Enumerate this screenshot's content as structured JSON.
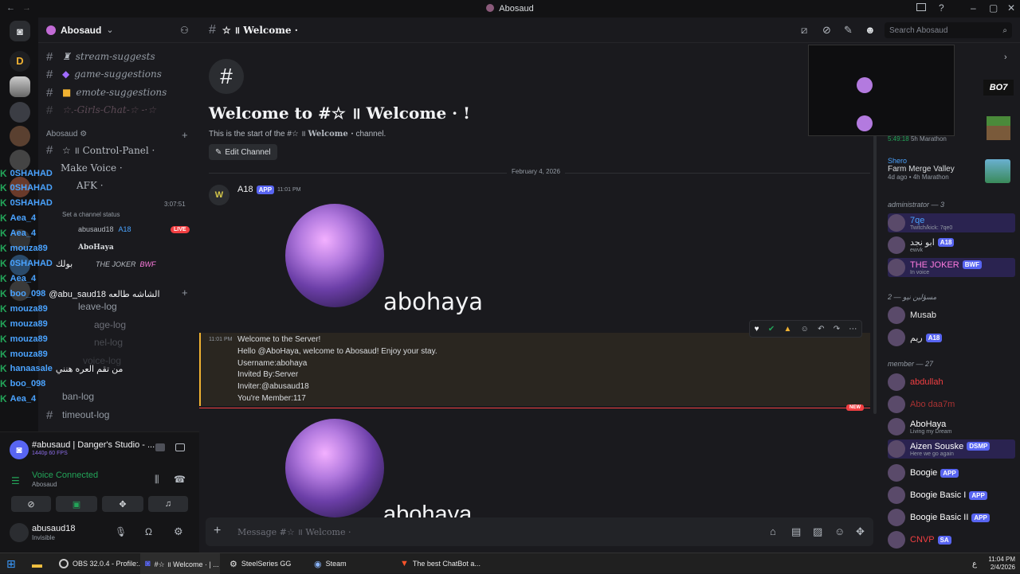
{
  "window": {
    "title": "Abosaud"
  },
  "server": {
    "name": "Abosaud",
    "dropdown": "⌄"
  },
  "channels": {
    "top": [
      {
        "label": "stream-suggests"
      },
      {
        "label": "game-suggestions"
      },
      {
        "label": "emote-suggestions"
      },
      {
        "label": "☆.-Girls-Chat-☆ -·☆"
      }
    ],
    "category": "Abosaud",
    "control_panel": "☆ ॥ Control-Panel ·",
    "make_voice": "Make Voice ·",
    "afk": "AFK ·",
    "voice_time": "3:07:51",
    "voice_status": "Set a channel status",
    "voice_user": "abusaud18",
    "voice_user_tag": "A18",
    "live": "LIVE",
    "voice_user2": "AboHaya",
    "voice_user3": "THE JOKER",
    "voice_user3_tag": "BWF",
    "logs": [
      "leave-log",
      "age-log",
      "nel-log",
      "voice-log",
      "ban-log",
      "timeout-log"
    ]
  },
  "overlay": {
    "rows": [
      {
        "name": "0SHAHAD",
        "text": ""
      },
      {
        "name": "0SHAHAD",
        "text": ""
      },
      {
        "name": "0SHAHAD",
        "text": ""
      },
      {
        "name": "Aea_4",
        "text": ""
      },
      {
        "name": "Aea_4",
        "text": ""
      },
      {
        "name": "mouza89",
        "text": ""
      },
      {
        "name": "0SHAHAD",
        "text": "بولك"
      },
      {
        "name": "Aea_4",
        "text": ""
      },
      {
        "name": "boo_098",
        "text": "@abu_saud18 الشاشه طالعه"
      },
      {
        "name": "mouza89",
        "text": ""
      },
      {
        "name": "mouza89",
        "text": ""
      },
      {
        "name": "mouza89",
        "text": ""
      },
      {
        "name": "mouza89",
        "text": ""
      },
      {
        "name": "hanaasale",
        "text": "من تقم العره هنني"
      },
      {
        "name": "boo_098",
        "text": ""
      },
      {
        "name": "Aea_4",
        "text": ""
      }
    ]
  },
  "user_panel": {
    "activity_title": "#abusaud | Danger's Studio - ...",
    "activity_sub": "1440p 60 FPS",
    "voice_connected": "Voice Connected",
    "voice_channel": "Abosaud",
    "username": "abusaud18",
    "status": "Invisible"
  },
  "header": {
    "channel": "☆ ॥ Welcome ·",
    "search_placeholder": "Search Abosaud"
  },
  "welcome": {
    "title": "Welcome to #☆ ॥ Welcome · !",
    "subtitle_pre": "This is the start of the #☆ ॥",
    "subtitle_channel": "Welcome ·",
    "subtitle_post": "channel.",
    "edit_button": "Edit Channel"
  },
  "divider_date": "February 4, 2026",
  "messages": [
    {
      "author": "A18",
      "tag": "APP",
      "time": "11:01 PM",
      "image_caption": "abohaya"
    },
    {
      "time": "11:01 PM",
      "lines": [
        "Welcome to the Server!",
        "Hello @AboHaya, welcome to Abosaud! Enjoy your stay.",
        "Username:abohaya",
        "Invited By:Server",
        "Inviter:@abusaud18",
        "You're Member:117"
      ],
      "new_badge": "NEW"
    },
    {
      "image_caption": "abohaya"
    }
  ],
  "composer": {
    "placeholder": "Message #☆ ॥ Welcome ·"
  },
  "members": {
    "activity1": {
      "time": "5:49:18",
      "extra": "5h Marathon"
    },
    "activity2": {
      "name": "Shero",
      "game": "Farm Merge Valley",
      "time": "4d ago",
      "extra": "4h Marathon"
    },
    "admin_header": "administrator — 3",
    "admins": [
      {
        "name": "7qe",
        "sub": "Twitch/kick: 7qe0",
        "color": "#4aa3ff"
      },
      {
        "name": "ابو نجد",
        "sub": "ewvk",
        "tag": "A18",
        "color": "#dbdee1"
      },
      {
        "name": "THE JOKER",
        "sub": "In voice",
        "tag": "BWF",
        "color": "#ff7be0"
      }
    ],
    "mod_header": "مسؤلين نيو — 2",
    "mods": [
      {
        "name": "Musab",
        "color": "#e6e6e6"
      },
      {
        "name": "ريم",
        "tag": "A18",
        "color": "#e6e6e6"
      }
    ],
    "member_header": "member — 27",
    "list": [
      {
        "name": "abdullah",
        "color": "#f23f42"
      },
      {
        "name": "Abo daa7m",
        "color": "#a83232"
      },
      {
        "name": "AboHaya",
        "sub": "Living my Dream",
        "color": "#ffffff"
      },
      {
        "name": "Aizen Souske",
        "sub": "Here we go again",
        "tag": "DSMP",
        "color": "#ffffff"
      },
      {
        "name": "Boogie",
        "tag": "APP",
        "color": "#ffffff"
      },
      {
        "name": "Boogie Basic I",
        "tag": "APP",
        "color": "#ffffff"
      },
      {
        "name": "Boogie Basic II",
        "tag": "APP",
        "color": "#ffffff"
      },
      {
        "name": "CNVP",
        "tag": "SA",
        "color": "#f23f42"
      }
    ]
  },
  "taskbar": {
    "items": [
      "OBS 32.0.4 - Profile:...",
      "#☆ ॥ Welcome · | ...",
      "SteelSeries GG",
      "Steam",
      "The best ChatBot a..."
    ],
    "time": "11:04 PM",
    "date": "2/4/2026",
    "lang": "ع"
  },
  "colors": {
    "accent": "#5865f2",
    "green": "#23a559",
    "red": "#f23f42",
    "bg": "#1a1a1e"
  }
}
